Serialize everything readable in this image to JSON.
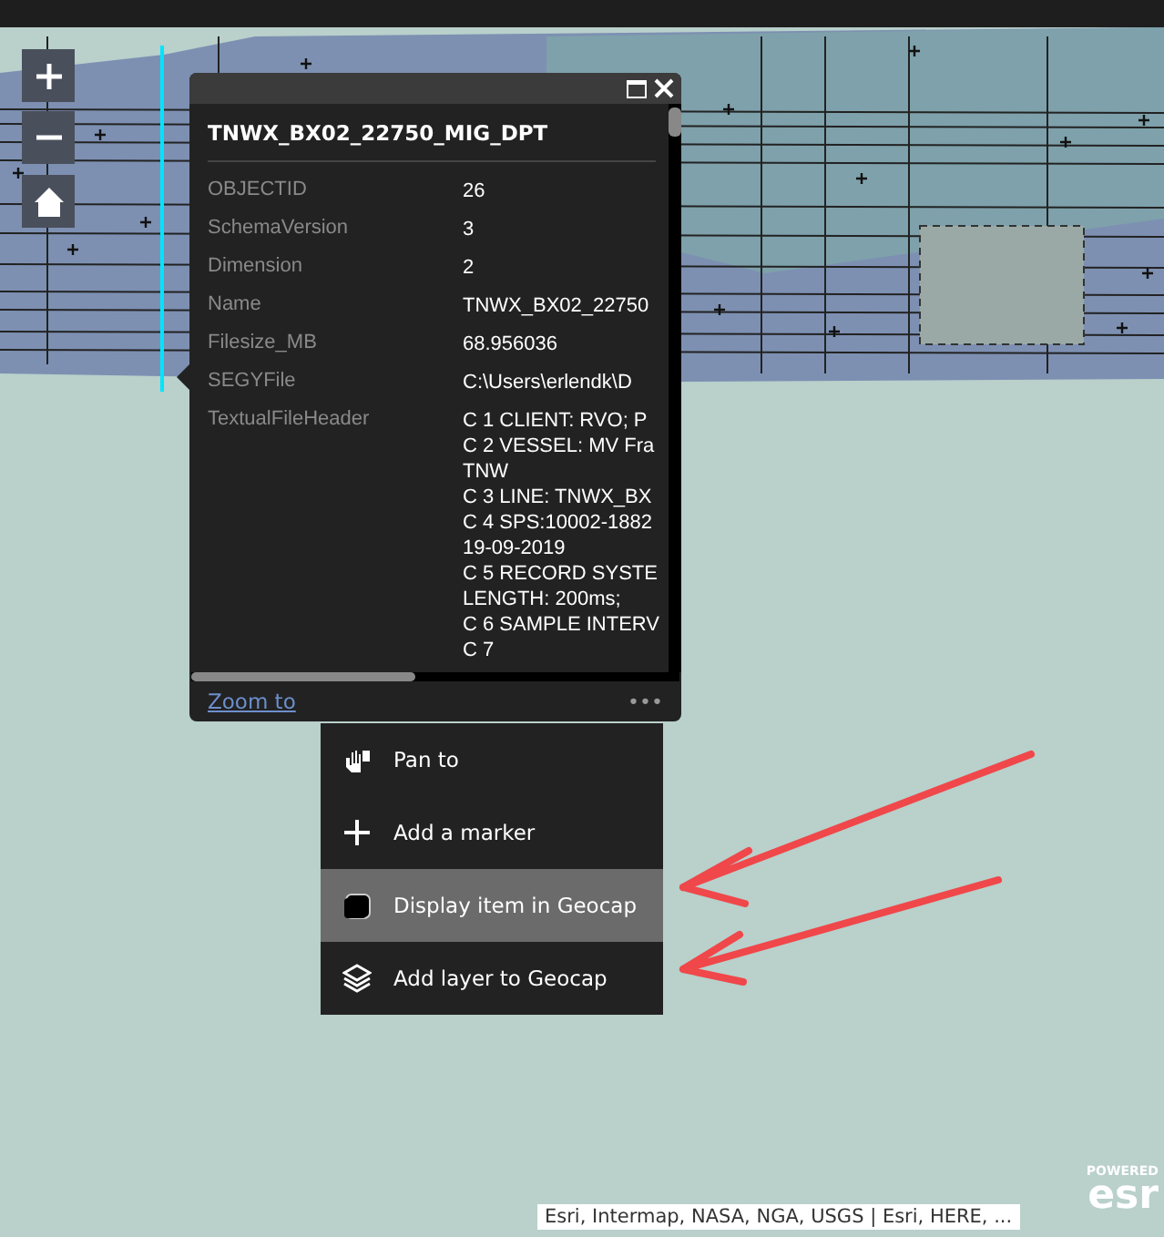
{
  "popup": {
    "title": "TNWX_BX02_22750_MIG_DPT",
    "fields": [
      {
        "label": "OBJECTID",
        "lines": [
          "26"
        ]
      },
      {
        "label": "SchemaVersion",
        "lines": [
          "3"
        ]
      },
      {
        "label": "Dimension",
        "lines": [
          "2"
        ]
      },
      {
        "label": "Name",
        "lines": [
          "TNWX_BX02_22750"
        ]
      },
      {
        "label": "Filesize_MB",
        "lines": [
          "68.956036"
        ]
      },
      {
        "label": "SEGYFile",
        "lines": [
          "C:\\Users\\erlendk\\D"
        ]
      },
      {
        "label": "TextualFileHeader",
        "lines": [
          "C 1 CLIENT: RVO; P",
          "C 2 VESSEL: MV Fra",
          "TNW",
          "C 3 LINE: TNWX_BX",
          "C 4 SPS:10002-1882",
          "19-09-2019",
          "C 5 RECORD SYSTE",
          "LENGTH: 200ms;",
          "C 6 SAMPLE INTERV",
          "C 7"
        ]
      }
    ],
    "footer_link": "Zoom to",
    "more": "•••"
  },
  "menu": [
    {
      "kind": "pan",
      "label": "Pan to",
      "selected": false
    },
    {
      "kind": "marker",
      "label": "Add a marker",
      "selected": false
    },
    {
      "kind": "cube",
      "label": "Display item in Geocap",
      "selected": true
    },
    {
      "kind": "layers",
      "label": "Add layer to Geocap",
      "selected": false
    }
  ],
  "attribution": "Esri, Intermap, NASA, NGA, USGS | Esri, HERE, ...",
  "logo": {
    "caption": "POWERED",
    "mark": "esr"
  }
}
